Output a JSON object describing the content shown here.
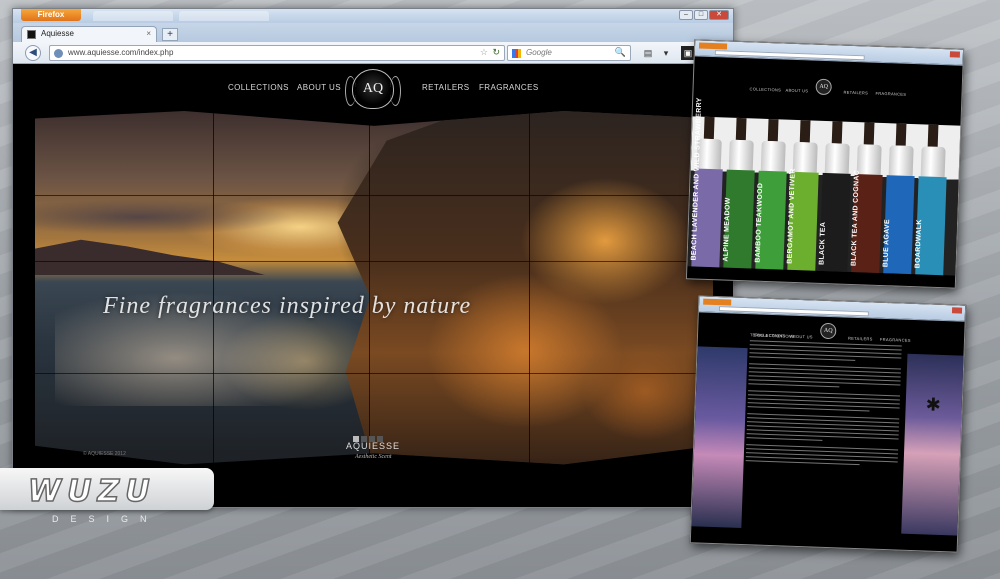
{
  "browser": {
    "menu_button": "Firefox",
    "tab_title": "Aquiesse",
    "tab_close": "×",
    "new_tab": "+",
    "url": "www.aquiesse.com/index.php",
    "search_placeholder": "Google",
    "back": "◀",
    "star": "☆",
    "reload": "↻",
    "search_go": "🔍"
  },
  "site": {
    "nav": [
      "COLLECTIONS",
      "ABOUT US",
      "RETAILERS",
      "FRAGRANCES"
    ],
    "logo": "AQ",
    "tagline": "Fine fragrances inspired by nature",
    "brand": "AQUIESSE",
    "brand_sub": "Aesthetic Scent",
    "copyright": "© AQUIESSE 2012"
  },
  "thumb_collections": {
    "products": [
      {
        "name": "BEACH LAVENDER AND WILD STRAWBERRY",
        "color": "#7b6aa8"
      },
      {
        "name": "ALPINE MEADOW",
        "color": "#2f7a2c"
      },
      {
        "name": "BAMBOO TEAKWOOD",
        "color": "#3e9e3a"
      },
      {
        "name": "BERGAMOT AND VETIVER",
        "color": "#6cae2e"
      },
      {
        "name": "BLACK TEA",
        "color": "#1c1c1c"
      },
      {
        "name": "BLACK TEA AND COGNAC",
        "color": "#5a2116"
      },
      {
        "name": "BLUE AGAVE",
        "color": "#1f67b8"
      },
      {
        "name": "BOARDWALK",
        "color": "#2a8fb7"
      }
    ]
  },
  "thumb_terms": {
    "title": "TERMS & CONDITIONS"
  },
  "watermark": {
    "logo": "WUZU",
    "sub": "DESIGN"
  }
}
